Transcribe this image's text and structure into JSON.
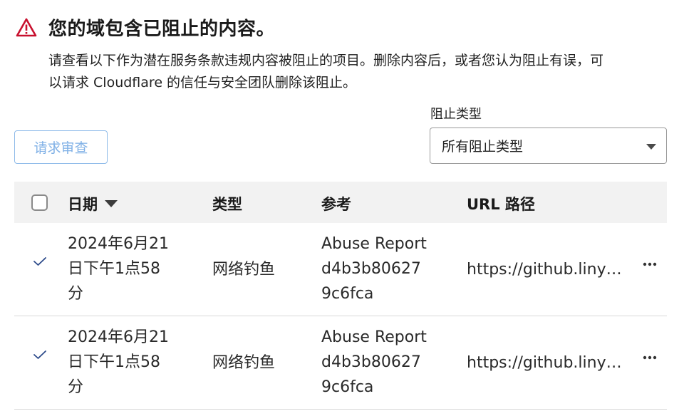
{
  "alert": {
    "icon": "warning-triangle-icon",
    "title": "您的域包含已阻止的内容。",
    "description_line1": "请查看以下作为潜在服务条款违规内容被阻止的项目。删除内容后，或者您认为阻止有误，可",
    "description_line2": "以请求 Cloudflare 的信任与安全团队删除该阻止。"
  },
  "toolbar": {
    "review_button": "请求审查",
    "filter_label": "阻止类型",
    "filter_value": "所有阻止类型"
  },
  "table": {
    "headers": {
      "date": "日期",
      "type": "类型",
      "reference": "参考",
      "url": "URL 路径"
    },
    "rows": [
      {
        "date_line1": "2024年6月21",
        "date_line2": "日下午1点58",
        "date_line3": "分",
        "type": "网络钓鱼",
        "ref_line1": "Abuse Report",
        "ref_line2": "d4b3b80627",
        "ref_line3": "9c6fca",
        "url": "https://github.liny…"
      },
      {
        "date_line1": "2024年6月21",
        "date_line2": "日下午1点58",
        "date_line3": "分",
        "type": "网络钓鱼",
        "ref_line1": "Abuse Report",
        "ref_line2": "d4b3b80627",
        "ref_line3": "9c6fca",
        "url": "https://github.liny…"
      }
    ]
  },
  "colors": {
    "warning": "#c8102e",
    "button_border": "#8fbbe9",
    "button_text": "#7fb0e6",
    "header_bg": "#f2f2f2",
    "check": "#2c4a8a"
  }
}
